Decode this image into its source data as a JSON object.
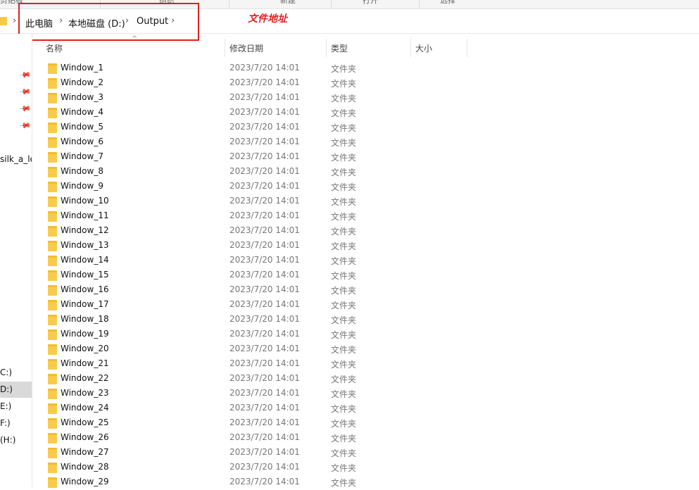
{
  "ribbon": {
    "labels": [
      "剪贴板",
      "组织",
      "新建",
      "打开",
      "选择"
    ]
  },
  "address_bar": {
    "crumbs": [
      "此电脑",
      "本地磁盘 (D:)",
      "Output"
    ],
    "annotation_label": "文件地址",
    "annotation_color": "#e02020"
  },
  "nav_pane": {
    "quick_access_item": "silk_a_le",
    "drives": [
      "C:)",
      "D:)",
      "E:)",
      "F:)",
      "(H:)"
    ],
    "selected_drive": "D:)"
  },
  "columns": {
    "name": "名称",
    "date": "修改日期",
    "type": "类型",
    "size": "大小"
  },
  "files": [
    {
      "name": "Window_1",
      "date": "2023/7/20 14:01",
      "type": "文件夹"
    },
    {
      "name": "Window_2",
      "date": "2023/7/20 14:01",
      "type": "文件夹"
    },
    {
      "name": "Window_3",
      "date": "2023/7/20 14:01",
      "type": "文件夹"
    },
    {
      "name": "Window_4",
      "date": "2023/7/20 14:01",
      "type": "文件夹"
    },
    {
      "name": "Window_5",
      "date": "2023/7/20 14:01",
      "type": "文件夹"
    },
    {
      "name": "Window_6",
      "date": "2023/7/20 14:01",
      "type": "文件夹"
    },
    {
      "name": "Window_7",
      "date": "2023/7/20 14:01",
      "type": "文件夹"
    },
    {
      "name": "Window_8",
      "date": "2023/7/20 14:01",
      "type": "文件夹"
    },
    {
      "name": "Window_9",
      "date": "2023/7/20 14:01",
      "type": "文件夹"
    },
    {
      "name": "Window_10",
      "date": "2023/7/20 14:01",
      "type": "文件夹"
    },
    {
      "name": "Window_11",
      "date": "2023/7/20 14:01",
      "type": "文件夹"
    },
    {
      "name": "Window_12",
      "date": "2023/7/20 14:01",
      "type": "文件夹"
    },
    {
      "name": "Window_13",
      "date": "2023/7/20 14:01",
      "type": "文件夹"
    },
    {
      "name": "Window_14",
      "date": "2023/7/20 14:01",
      "type": "文件夹"
    },
    {
      "name": "Window_15",
      "date": "2023/7/20 14:01",
      "type": "文件夹"
    },
    {
      "name": "Window_16",
      "date": "2023/7/20 14:01",
      "type": "文件夹"
    },
    {
      "name": "Window_17",
      "date": "2023/7/20 14:01",
      "type": "文件夹"
    },
    {
      "name": "Window_18",
      "date": "2023/7/20 14:01",
      "type": "文件夹"
    },
    {
      "name": "Window_19",
      "date": "2023/7/20 14:01",
      "type": "文件夹"
    },
    {
      "name": "Window_20",
      "date": "2023/7/20 14:01",
      "type": "文件夹"
    },
    {
      "name": "Window_21",
      "date": "2023/7/20 14:01",
      "type": "文件夹"
    },
    {
      "name": "Window_22",
      "date": "2023/7/20 14:01",
      "type": "文件夹"
    },
    {
      "name": "Window_23",
      "date": "2023/7/20 14:01",
      "type": "文件夹"
    },
    {
      "name": "Window_24",
      "date": "2023/7/20 14:01",
      "type": "文件夹"
    },
    {
      "name": "Window_25",
      "date": "2023/7/20 14:01",
      "type": "文件夹"
    },
    {
      "name": "Window_26",
      "date": "2023/7/20 14:01",
      "type": "文件夹"
    },
    {
      "name": "Window_27",
      "date": "2023/7/20 14:01",
      "type": "文件夹"
    },
    {
      "name": "Window_28",
      "date": "2023/7/20 14:01",
      "type": "文件夹"
    },
    {
      "name": "Window_29",
      "date": "2023/7/20 14:01",
      "type": "文件夹"
    }
  ]
}
